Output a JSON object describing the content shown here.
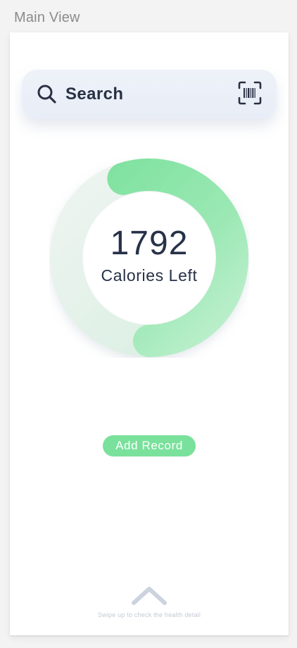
{
  "page_label": "Main View",
  "search": {
    "placeholder": "Search",
    "icon": "search-icon",
    "scan_icon": "barcode-scan-icon"
  },
  "calorie_ring": {
    "value": "1792",
    "label": "Calories Left",
    "progress_fraction": 0.55,
    "colors": {
      "arc_start": "#79e19b",
      "arc_end": "#b9f0cc",
      "track_start": "#d9f2e3",
      "track_end": "#e6f5ec"
    }
  },
  "actions": {
    "add_record_label": "Add Record"
  },
  "swipe": {
    "icon": "chevron-up-icon",
    "hint": "Swipe up to check the health detail"
  },
  "colors": {
    "accent": "#79e19b",
    "text_primary": "#273148",
    "page_label": "#8b8b8b",
    "hint": "#c3c9d3"
  }
}
